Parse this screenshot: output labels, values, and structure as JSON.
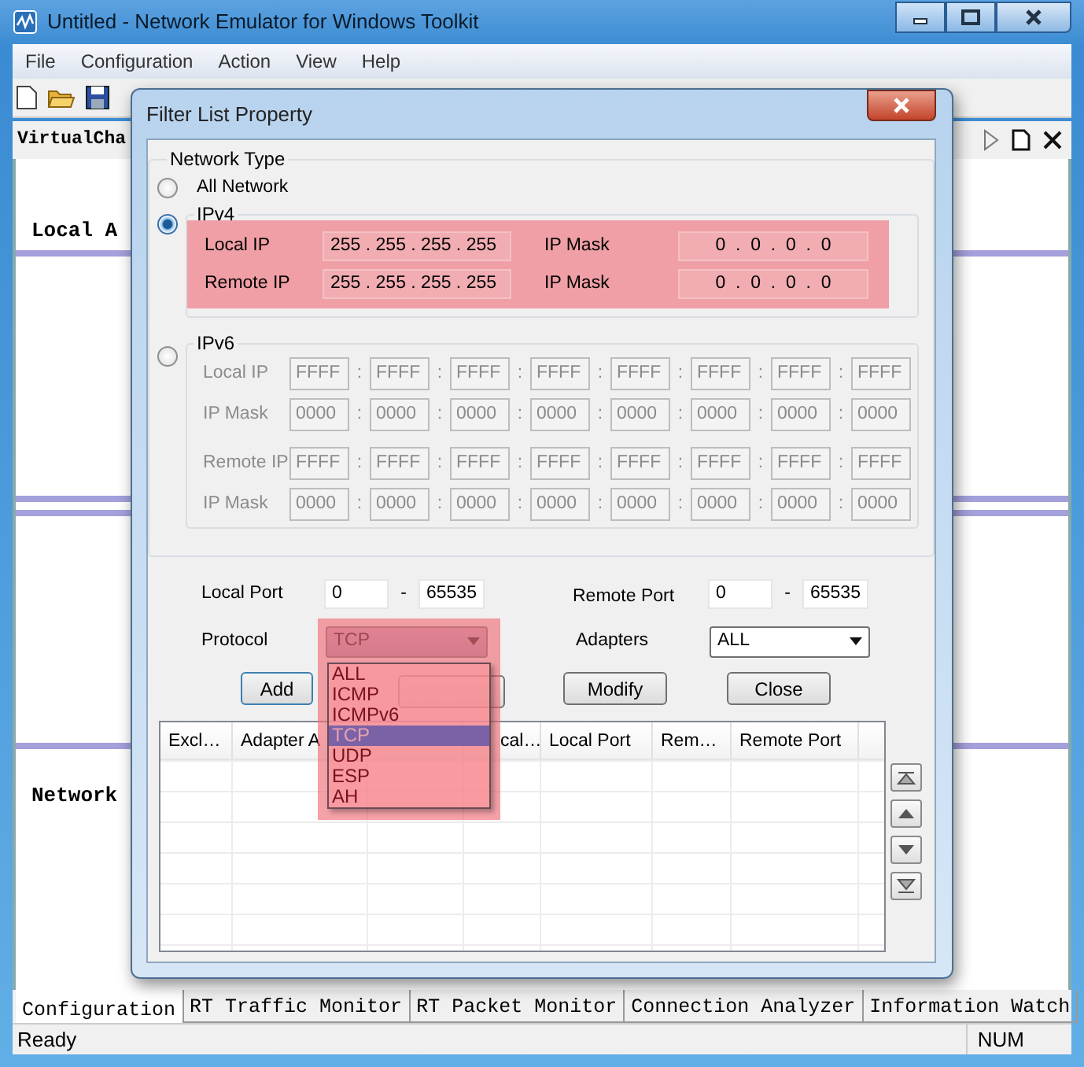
{
  "window": {
    "title": "Untitled - Network Emulator for Windows Toolkit"
  },
  "menu": [
    "File",
    "Configuration",
    "Action",
    "View",
    "Help"
  ],
  "document_tab": {
    "label": "VirtualCha"
  },
  "canvas": {
    "labels": [
      "Local A",
      "Network"
    ]
  },
  "dialog": {
    "title": "Filter List Property",
    "network_type": {
      "label": "Network Type",
      "options": [
        {
          "label": "All Network",
          "selected": false
        },
        {
          "label": "IPv4",
          "selected": true
        },
        {
          "label": "IPv6",
          "selected": false
        }
      ]
    },
    "ipv4": {
      "rows": [
        {
          "label": "Local IP",
          "ip": "255 . 255 . 255 . 255",
          "mask_label": "IP Mask",
          "mask": "0  .  0  .  0  .  0"
        },
        {
          "label": "Remote IP",
          "ip": "255 . 255 . 255 . 255",
          "mask_label": "IP Mask",
          "mask": "0  .  0  .  0  .  0"
        }
      ]
    },
    "ipv6": {
      "disabled": true,
      "separator": ":",
      "rows": [
        {
          "label": "Local IP",
          "groups": [
            "FFFF",
            "FFFF",
            "FFFF",
            "FFFF",
            "FFFF",
            "FFFF",
            "FFFF",
            "FFFF"
          ]
        },
        {
          "label": "IP Mask",
          "groups": [
            "0000",
            "0000",
            "0000",
            "0000",
            "0000",
            "0000",
            "0000",
            "0000"
          ]
        },
        {
          "label": "Remote IP",
          "groups": [
            "FFFF",
            "FFFF",
            "FFFF",
            "FFFF",
            "FFFF",
            "FFFF",
            "FFFF",
            "FFFF"
          ]
        },
        {
          "label": "IP Mask",
          "groups": [
            "0000",
            "0000",
            "0000",
            "0000",
            "0000",
            "0000",
            "0000",
            "0000"
          ]
        }
      ]
    },
    "local_port": {
      "label": "Local Port",
      "from": "0",
      "dash": "-",
      "to": "65535"
    },
    "remote_port": {
      "label": "Remote Port",
      "from": "0",
      "dash": "-",
      "to": "65535"
    },
    "protocol": {
      "label": "Protocol",
      "value": "TCP",
      "expanded": true,
      "options": [
        {
          "label": "ALL",
          "selected": false
        },
        {
          "label": "ICMP",
          "selected": false
        },
        {
          "label": "ICMPv6",
          "selected": false
        },
        {
          "label": "TCP",
          "selected": true
        },
        {
          "label": "UDP",
          "selected": false
        },
        {
          "label": "ESP",
          "selected": false
        },
        {
          "label": "AH",
          "selected": false
        }
      ]
    },
    "adapters": {
      "label": "Adapters",
      "value": "ALL"
    },
    "buttons": [
      "Add",
      "Modify",
      "Close"
    ],
    "table": {
      "columns": [
        "Excl…",
        "Adapter A",
        "cal…",
        "Local Port",
        "Rem…",
        "Remote Port"
      ]
    }
  },
  "bottom_tabs": [
    {
      "label": "Configuration",
      "selected": true
    },
    {
      "label": "RT Traffic Monitor",
      "selected": false
    },
    {
      "label": "RT Packet Monitor",
      "selected": false
    },
    {
      "label": "Connection Analyzer",
      "selected": false
    },
    {
      "label": "Information Watch",
      "selected": false
    }
  ],
  "status_bar": {
    "text": "Ready",
    "indicator": "NUM"
  }
}
